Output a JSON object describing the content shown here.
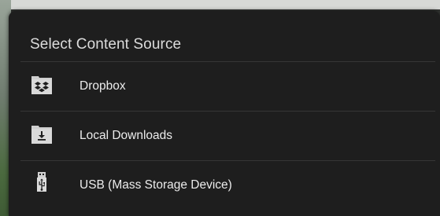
{
  "dialog": {
    "title": "Select Content Source",
    "items": [
      {
        "label": "Dropbox",
        "icon": "dropbox-folder-icon"
      },
      {
        "label": "Local Downloads",
        "icon": "download-folder-icon"
      },
      {
        "label": "USB (Mass Storage Device)",
        "icon": "usb-icon"
      }
    ]
  },
  "colors": {
    "dialog_background": "#1e1e1e",
    "divider": "#363636",
    "text": "#ececec",
    "icon": "#dcdcdc"
  }
}
